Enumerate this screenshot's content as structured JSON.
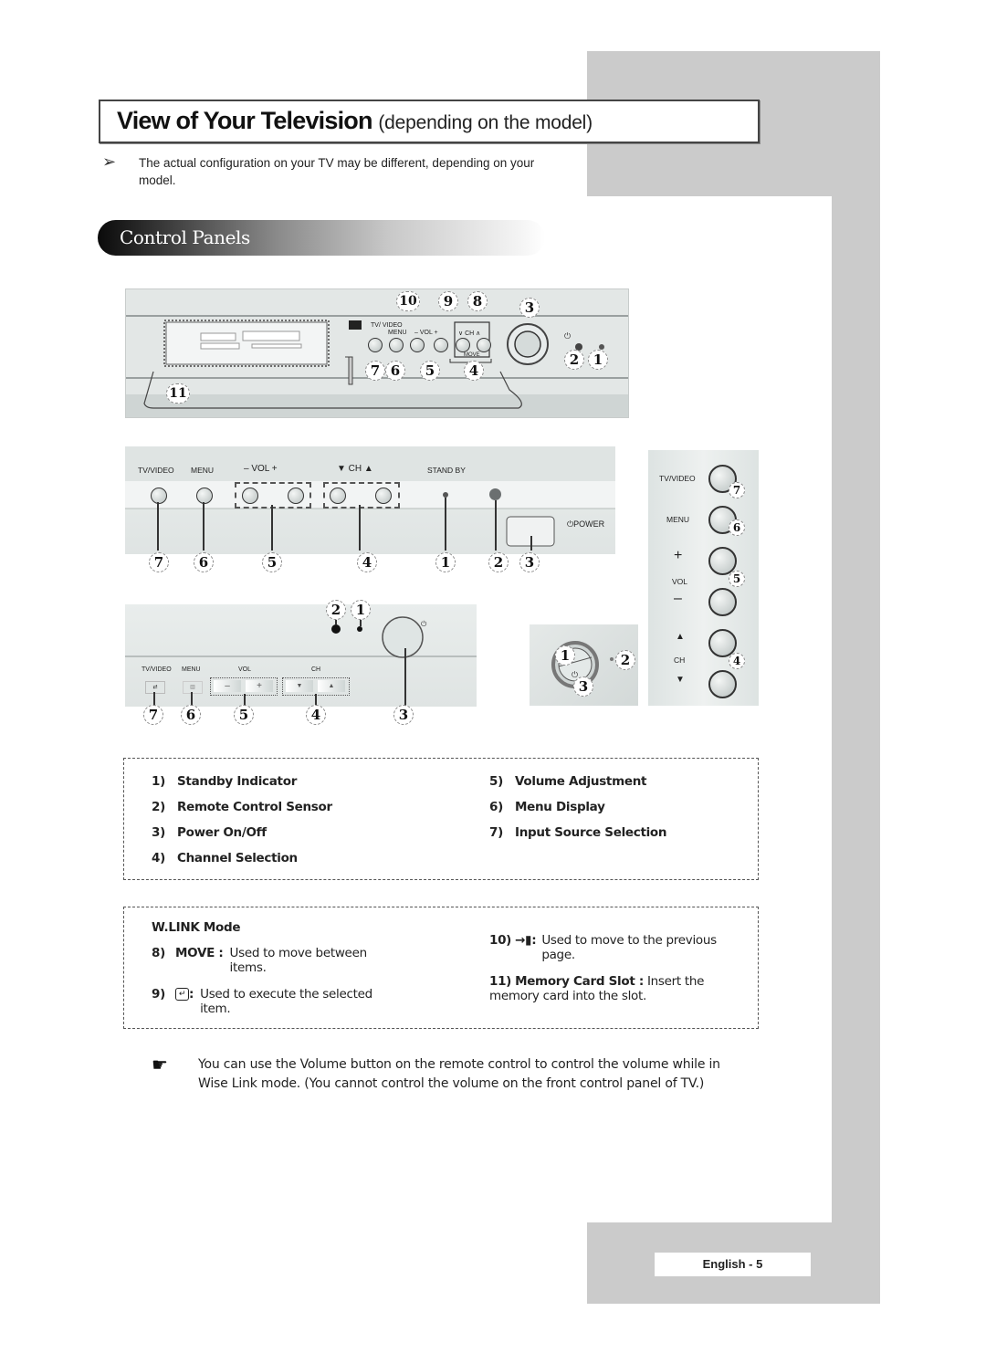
{
  "page": {
    "title_main": "View of Your Television",
    "title_sub": "(depending on the model)",
    "note_icon": "arrow-right-icon",
    "note_text": "The actual configuration on your TV may be different, depending on your model.",
    "section_title": "Control Panels",
    "footer": "English - 5"
  },
  "panel1": {
    "labels": {
      "tv_video": "TV/ VIDEO",
      "menu": "MENU",
      "vol": "– VOL +",
      "ch": "∨ CH ∧",
      "move": "MOVE"
    },
    "callouts": [
      "10",
      "9",
      "8",
      "3",
      "7",
      "6",
      "5",
      "4",
      "2",
      "1",
      "11"
    ]
  },
  "panel2": {
    "labels": {
      "tv_video": "TV/VIDEO",
      "menu": "MENU",
      "vol": "–  VOL  +",
      "ch": "▼  CH  ▲",
      "standby": "STAND BY",
      "power": "POWER"
    },
    "callouts": [
      "7",
      "6",
      "5",
      "4",
      "1",
      "2",
      "3"
    ]
  },
  "panel3": {
    "labels": {
      "tv_video": "TV/VIDEO",
      "menu": "MENU",
      "vol": "VOL",
      "ch": "CH",
      "minus": "–",
      "plus": "+",
      "down": "▼",
      "up": "▲"
    },
    "callouts": [
      "2",
      "1",
      "7",
      "6",
      "5",
      "4",
      "3"
    ]
  },
  "panel4": {
    "callouts": [
      "1",
      "2",
      "3"
    ]
  },
  "panel5": {
    "labels": {
      "tv_video": "TV/VIDEO",
      "menu": "MENU",
      "plus": "+",
      "vol": "VOL",
      "minus": "–",
      "up": "▲",
      "ch": "CH",
      "down": "▼"
    },
    "callouts": [
      "7",
      "6",
      "5",
      "4"
    ]
  },
  "legend": {
    "items": [
      {
        "num": "1)",
        "label": "Standby Indicator"
      },
      {
        "num": "2)",
        "label": "Remote Control Sensor"
      },
      {
        "num": "3)",
        "label": "Power On/Off"
      },
      {
        "num": "4)",
        "label": "Channel Selection"
      },
      {
        "num": "5)",
        "label": "Volume Adjustment"
      },
      {
        "num": "6)",
        "label": "Menu Display"
      },
      {
        "num": "7)",
        "label": "Input Source Selection"
      }
    ]
  },
  "wlink": {
    "heading": "W.LINK Mode",
    "items": [
      {
        "num": "8)",
        "key": "MOVE :",
        "text": "Used to move between items."
      },
      {
        "num": "9)",
        "key_icon": "enter-icon",
        "key": ":",
        "text": "Used to execute the selected item."
      },
      {
        "num": "10)",
        "key_icon": "exit-door-icon",
        "key": ":",
        "text": "Used to move to the previous page."
      },
      {
        "num": "11)",
        "key": "Memory Card Slot :",
        "text": "Insert the memory card into the slot."
      }
    ]
  },
  "tip": {
    "icon": "pointing-hand-icon",
    "text": "You can use the Volume button on the remote control to control the volume while in Wise Link mode. (You cannot control the volume on the front control panel of TV.)"
  }
}
